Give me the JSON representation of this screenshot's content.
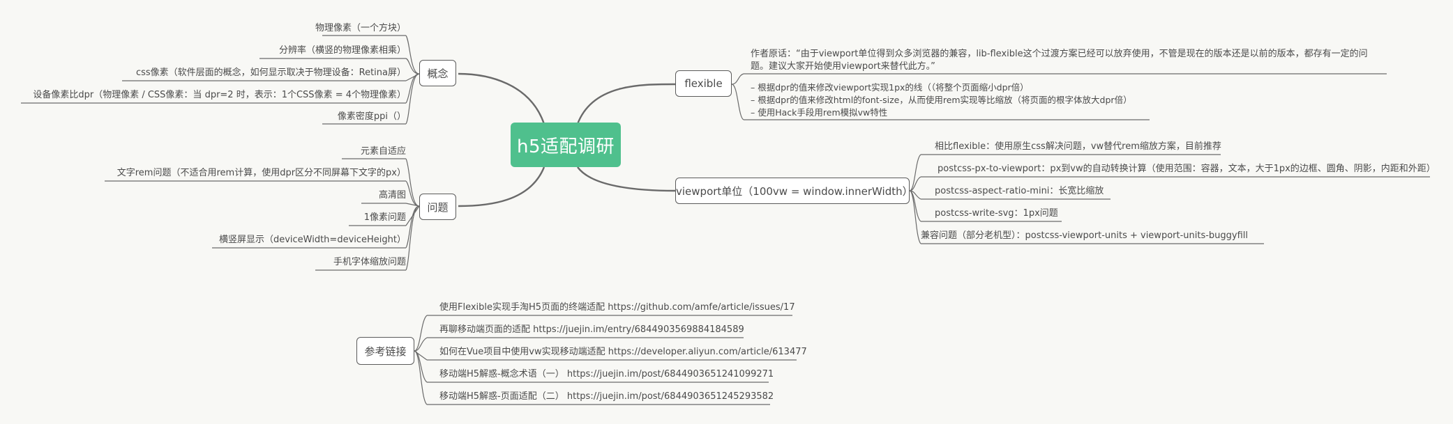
{
  "root": {
    "label": "h5适配调研"
  },
  "concept": {
    "label": "概念",
    "items": [
      "物理像素（一个方块）",
      "分辨率（横竖的物理像素相乘）",
      "css像素（软件层面的概念，如何显示取决于物理设备：Retina屏）",
      "设备像素比dpr（物理像素 / CSS像素：当 dpr=2 时，表示：1个CSS像素 = 4个物理像素）",
      "像素密度ppi（）"
    ]
  },
  "problems": {
    "label": "问题",
    "items": [
      "元素自适应",
      "文字rem问题（不适合用rem计算，使用dpr区分不同屏幕下文字的px）",
      "高清图",
      "1像素问题",
      "横竖屏显示（deviceWidth=deviceHeight）",
      "手机字体缩放问题"
    ]
  },
  "flexible": {
    "label": "flexible",
    "quote_line1": "作者原话：“由于viewport单位得到众多浏览器的兼容，lib-flexible这个过渡方案已经可以放弃使用，不管是现在的版本还是以前的版本，都存有一定的问",
    "quote_line2": "题。建议大家开始使用viewport来替代此方。”",
    "bullets": [
      "– 根据dpr的值来修改viewport实现1px的线（（将整个页面缩小dpr倍）",
      "– 根据dpr的值来修改html的font-size，从而使用rem实现等比缩放（将页面的根字体放大dpr倍）",
      "– 使用Hack手段用rem模拟vw特性"
    ]
  },
  "viewport": {
    "label": "viewport单位（100vw = window.innerWidth）",
    "items": [
      "相比flexible：使用原生css解决问题，vw替代rem缩放方案，目前推荐",
      "postcss-px-to-viewport：px到vw的自动转换计算（使用范围：容器，文本，大于1px的边框、圆角、阴影，内距和外距）",
      "postcss-aspect-ratio-mini：长宽比缩放",
      "postcss-write-svg：1px问题",
      "兼容问题（部分老机型）：postcss-viewport-units + viewport-units-buggyfill"
    ]
  },
  "references": {
    "label": "参考链接",
    "items": [
      "使用Flexible实现手淘H5页面的终端适配 https://github.com/amfe/article/issues/17",
      "再聊移动端页面的适配 https://juejin.im/entry/6844903569884184589",
      "如何在Vue项目中使用vw实现移动端适配 https://developer.aliyun.com/article/613477",
      "移动端H5解惑-概念术语（一） https://juejin.im/post/6844903651241099271",
      "移动端H5解惑-页面适配（二） https://juejin.im/post/6844903651245293582"
    ]
  },
  "colors": {
    "root": "#4fc08d",
    "line": "#6a6a6a",
    "background": "#f8f8f5"
  }
}
